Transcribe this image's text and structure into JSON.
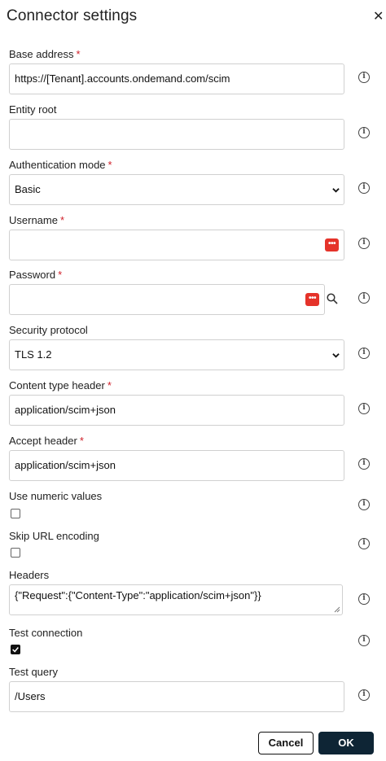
{
  "dialog": {
    "title": "Connector settings",
    "close_glyph": "✕"
  },
  "fields": {
    "base_address": {
      "label": "Base address",
      "value": "https://[Tenant].accounts.ondemand.com/scim"
    },
    "entity_root": {
      "label": "Entity root",
      "value": ""
    },
    "auth_mode": {
      "label": "Authentication mode",
      "value": "Basic"
    },
    "username": {
      "label": "Username",
      "value": ""
    },
    "password": {
      "label": "Password",
      "value": ""
    },
    "security_protocol": {
      "label": "Security protocol",
      "value": "TLS 1.2"
    },
    "content_type": {
      "label": "Content type header",
      "value": "application/scim+json"
    },
    "accept_header": {
      "label": "Accept header",
      "value": "application/scim+json"
    },
    "numeric_values": {
      "label": "Use numeric values",
      "checked": false
    },
    "skip_url_encoding": {
      "label": "Skip URL encoding",
      "checked": false
    },
    "headers": {
      "label": "Headers",
      "value": "{\"Request\":{\"Content-Type\":\"application/scim+json\"}}"
    },
    "test_connection": {
      "label": "Test connection",
      "checked": true
    },
    "test_query": {
      "label": "Test query",
      "value": "/Users"
    }
  },
  "required_marker": "*",
  "password_manager_glyph": "•••",
  "info_glyph": "i",
  "buttons": {
    "cancel": "Cancel",
    "ok": "OK"
  },
  "colors": {
    "required": "#d0202a",
    "ok_bg": "#0e2535",
    "pw_manager": "#e5332a"
  }
}
